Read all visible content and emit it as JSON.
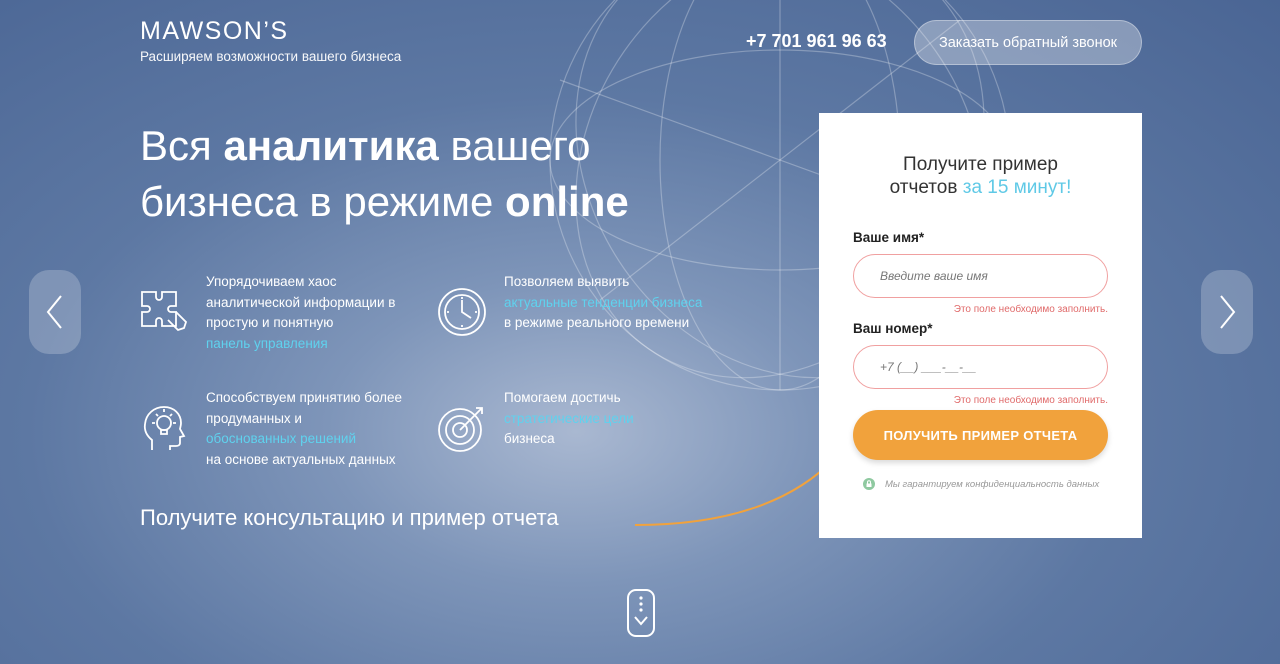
{
  "brand": {
    "name": "MAWSON’S",
    "tagline": "Расширяем возможности вашего бизнеса"
  },
  "header": {
    "phone": "+7 701 961 96 63",
    "callback_label": "Заказать обратный звонок"
  },
  "hero": {
    "line1_a": "Вся ",
    "line1_b": "аналитика",
    "line1_c": " вашего",
    "line2_a": "бизнеса в режиме ",
    "line2_b": "online"
  },
  "features": [
    {
      "icon": "puzzle-icon",
      "lines": [
        "Упорядочиваем хаос",
        "аналитической информации в",
        "простую и понятную"
      ],
      "highlight": "панель управления",
      "after": ""
    },
    {
      "icon": "clock-icon",
      "lines": [
        "Позволяем выявить"
      ],
      "highlight": "актуальные тенденции бизнеса",
      "after": "в режиме реального времени"
    },
    {
      "icon": "head-lightbulb-icon",
      "lines": [
        "Способствуем принятию более",
        "продуманных и"
      ],
      "highlight": "обоснованных решений",
      "after": "на основе актуальных данных"
    },
    {
      "icon": "target-icon",
      "lines": [
        "Помогаем достичь"
      ],
      "highlight": "стратегические цели",
      "after": "бизнеса"
    }
  ],
  "consult_text": "Получите консультацию и пример отчета",
  "form": {
    "title_line1": "Получите пример",
    "title_line2_a": "отчетов ",
    "title_line2_b": "за 15 минут!",
    "name_label": "Ваше имя*",
    "name_placeholder": "Введите ваше имя",
    "name_error": "Это поле необходимо заполнить.",
    "phone_label": "Ваш номер*",
    "phone_placeholder": "+7 (__) ___-__-__",
    "phone_error": "Это поле необходимо заполнить.",
    "submit_label": "ПОЛУЧИТЬ ПРИМЕР ОТЧЕТА",
    "privacy": "Мы гарантируем конфиденциальность данных"
  },
  "colors": {
    "accent_orange": "#f1a23c",
    "accent_cyan": "#5fd2ee",
    "error_red": "#e06a6a"
  }
}
